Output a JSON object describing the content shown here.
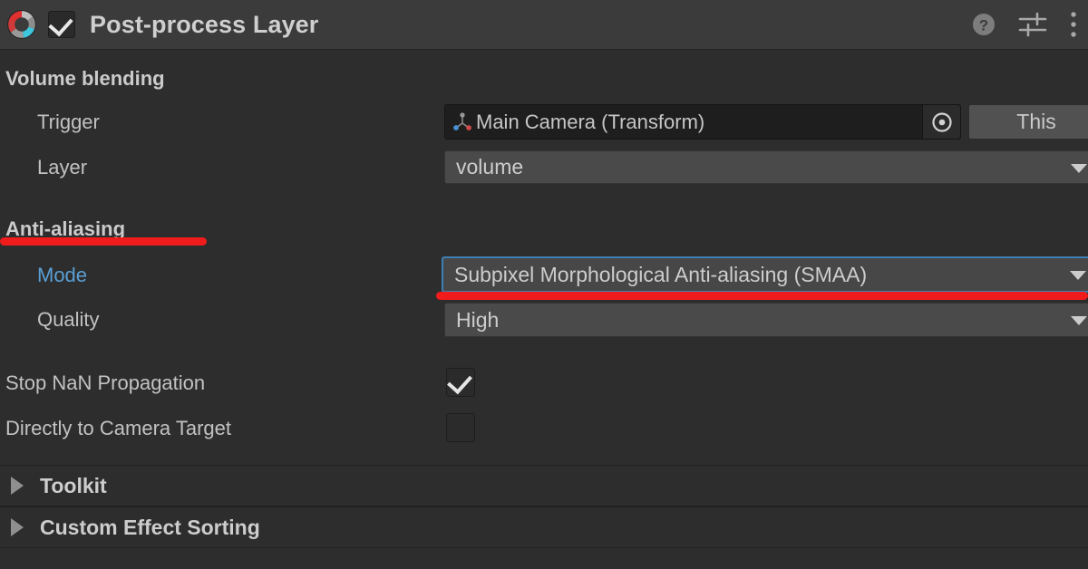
{
  "header": {
    "title": "Post-process Layer",
    "enabled_checkbox": true,
    "icon": "post-process-layer-icon",
    "tools": [
      {
        "name": "help-icon",
        "label": "?"
      },
      {
        "name": "preset-settings-icon",
        "label": ""
      },
      {
        "name": "more-menu-icon",
        "label": ""
      }
    ]
  },
  "sections": {
    "volume_blending": {
      "title": "Volume blending",
      "trigger": {
        "label": "Trigger",
        "value": "Main Camera (Transform)",
        "icon": "transform-component-icon",
        "picker_icon": "object-picker-icon",
        "this_button": "This"
      },
      "layer": {
        "label": "Layer",
        "value": "volume"
      }
    },
    "anti_aliasing": {
      "title": "Anti-aliasing",
      "mode": {
        "label": "Mode",
        "value": "Subpixel Morphological Anti-aliasing (SMAA)",
        "modified": true,
        "focused": true
      },
      "quality": {
        "label": "Quality",
        "value": "High"
      }
    }
  },
  "toggles": [
    {
      "label": "Stop NaN Propagation",
      "checked": true
    },
    {
      "label": "Directly to Camera Target",
      "checked": false
    }
  ],
  "foldouts": [
    {
      "label": "Toolkit",
      "expanded": false
    },
    {
      "label": "Custom Effect Sorting",
      "expanded": false
    }
  ],
  "annotations": {
    "color": "#f01c1c",
    "marks": [
      {
        "name": "anti-aliasing-underline",
        "target": "Anti-aliasing"
      },
      {
        "name": "mode-dropdown-underline",
        "target": "Mode dropdown"
      }
    ]
  },
  "colors": {
    "header_bg": "#3b3b3b",
    "body_bg": "#2d2d2d",
    "dropdown_bg": "#4a4a4a",
    "object_field_bg": "#1e1e1e",
    "modified_label": "#5a9fd4",
    "focus_border": "#3d7fb5",
    "annotation_red": "#f01c1c"
  }
}
